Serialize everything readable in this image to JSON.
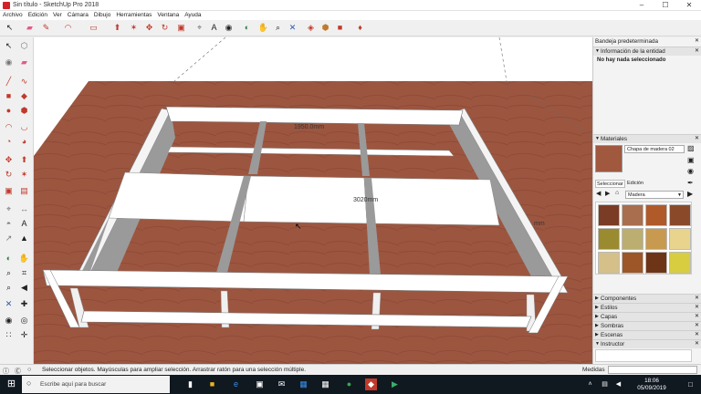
{
  "window": {
    "title": "Sin título - SketchUp Pro 2018",
    "minimize": "–",
    "maximize": "☐",
    "close": "✕"
  },
  "menu": [
    "Archivo",
    "Edición",
    "Ver",
    "Cámara",
    "Dibujo",
    "Herramientas",
    "Ventana",
    "Ayuda"
  ],
  "viewport": {
    "dim_top": "1950.0mm",
    "dim_mid": "3020mm",
    "dim_right": "mm",
    "colors": {
      "wood": "#9c5640",
      "panel": "#ffffff",
      "shade": "#9a9a9a"
    }
  },
  "tray": {
    "title": "Bandeja predeterminada",
    "entity_info": {
      "header": "Información de la entidad",
      "message": "No hay nada seleccionado"
    },
    "materials": {
      "header": "Materiales",
      "name": "Chapa de madera 02",
      "tab_select": "Seleccionar",
      "tab_edit": "Edición",
      "library": "Madera",
      "swatches": [
        "#7a3c24",
        "#a86e4e",
        "#b05a2a",
        "#8a4a2a",
        "#9a8a30",
        "#bcae70",
        "#c89a50",
        "#e8d48c",
        "#d6c08a",
        "#9c5628",
        "#6e3418",
        "#d8cc40"
      ]
    },
    "collapsed": [
      "Componentes",
      "Estilos",
      "Capas",
      "Sombras",
      "Escenas",
      "Instructor"
    ]
  },
  "status": {
    "message": "Seleccionar objetos. Mayúsculas para ampliar selección. Arrastrar ratón para una selección múltiple.",
    "measures_label": "Medidas"
  },
  "taskbar": {
    "search_placeholder": "Escribe aquí para buscar",
    "time": "18:06",
    "date": "05/09/2019"
  }
}
